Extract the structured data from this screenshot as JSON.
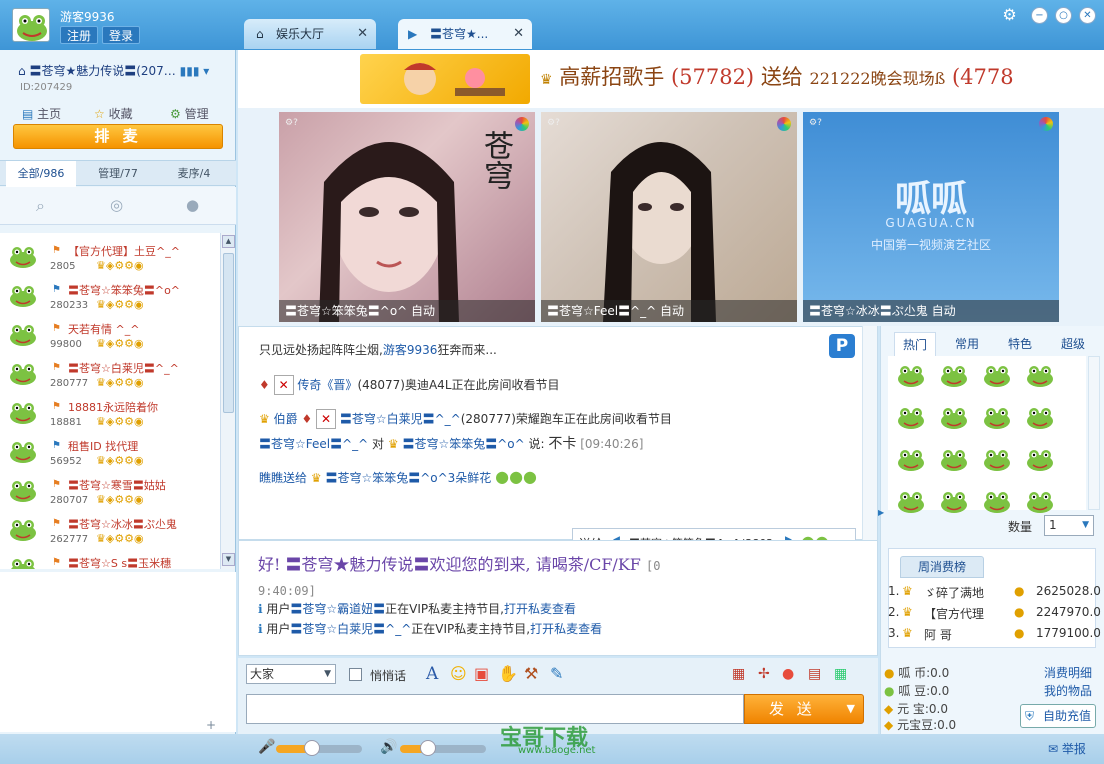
{
  "header": {
    "username": "游客9936",
    "register_label": "注册",
    "login_label": "登录",
    "tabs": [
      {
        "label": "娱乐大厅",
        "close": "✕"
      },
      {
        "label": "〓苍穹★...",
        "close": "✕"
      }
    ]
  },
  "sidebar": {
    "room_name": "〓苍穹★魅力传说〓(207…",
    "room_id": "ID:207429",
    "nav": [
      {
        "label": "主页",
        "icon": "page-icon"
      },
      {
        "label": "收藏",
        "icon": "star-icon"
      },
      {
        "label": "管理",
        "icon": "gear-icon"
      }
    ],
    "queue_button": "排 麦",
    "tabs": [
      {
        "label": "全部/986"
      },
      {
        "label": "管理/77"
      },
      {
        "label": "麦序/4"
      }
    ],
    "users": [
      {
        "name": "【官方代理】土豆^_^",
        "id": "2805",
        "color": "#c0392b"
      },
      {
        "name": "〓苍穹☆笨笨兔〓^o^",
        "id": "280233",
        "color": "#c0392b"
      },
      {
        "name": "天若有情 ^_^",
        "id": "99800",
        "color": "#c0392b"
      },
      {
        "name": "〓苍穹☆白莱児〓^_^",
        "id": "280777",
        "color": "#c0392b"
      },
      {
        "name": "18881永远陪着你",
        "id": "18881",
        "color": "#c0392b"
      },
      {
        "name": "租售ID 找代理",
        "id": "56952",
        "color": "#c0392b"
      },
      {
        "name": "〓苍穹☆寒雪〓姑姑",
        "id": "280707",
        "color": "#c0392b"
      },
      {
        "name": "〓苍穹☆冰冰〓ぷ尐鬼",
        "id": "262777",
        "color": "#c0392b"
      },
      {
        "name": "〓苍穹☆S s〓玉米穗",
        "id": "",
        "color": "#c0392b"
      }
    ]
  },
  "banner": {
    "text_a": "高薪招歌手",
    "num_a": "(57782)",
    "text_b": "送给",
    "text_c": "221222晚会现场ß",
    "num_b": "(4778"
  },
  "videos": [
    {
      "caption": "〓苍穹☆笨笨兔〓^o^  自动",
      "overlay": "苍穹"
    },
    {
      "caption": "〓苍穹☆Feel〓^_^   自动",
      "overlay": ""
    },
    {
      "caption": "〓苍穹☆冰冰〓ぷ尐鬼 自动",
      "overlay": "呱呱",
      "overlay2": "GUAGUA.CN",
      "overlay3": "中国第一视频演艺社区"
    }
  ],
  "chat": {
    "line1": "只见远处扬起阵阵尘烟,",
    "line1_user": "游客9936",
    "line1_tail": "狂奔而来...",
    "line2_user": "传奇《晋》",
    "line2_tail": "(48077)奥迪A4L正在此房间收看节目",
    "line3_user": "伯爵",
    "line3_user2": "〓苍穹☆白莱児〓^_^",
    "line3_tail": "(280777)荣耀跑车正在此房间收看节目",
    "line4_user": "〓苍穹☆Feel〓^_^",
    "line4_to": "对",
    "line4_target": "〓苍穹☆笨笨兔〓^o^",
    "line4_say": "说:",
    "line4_msg": "不卡",
    "line4_time": "[09:40:26]",
    "line5_a": "瞧瞧送给",
    "line5_target": "〓苍穹☆笨笨兔〓^o^3朵鲜花",
    "p_badge": "P"
  },
  "gift_send": {
    "label": "送给",
    "target": "〓苍穹☆笨笨兔〓^o^(2802"
  },
  "public": {
    "welcome": "好! 〓苍穹★魅力传说〓欢迎您的到来, 请喝茶/CF/KF",
    "welcome_time": "[0",
    "welcome_time2": "9:40:09]",
    "sys1_a": "用户",
    "sys1_user": "〓苍穹☆霸道妞〓",
    "sys1_b": "正在VIP私麦主持节目,",
    "sys1_link": "打开私麦查看",
    "sys2_a": "用户",
    "sys2_user": "〓苍穹☆白莱児〓^_^",
    "sys2_b": "正在VIP私麦主持节目,",
    "sys2_link": "打开私麦查看"
  },
  "input": {
    "target": "大家",
    "whisper_label": "悄悄话",
    "send_label": "发 送"
  },
  "right": {
    "tabs": [
      "热门",
      "常用",
      "特色",
      "超级"
    ],
    "qty_label": "数量",
    "qty_value": "1",
    "weekly_title": "周消费榜",
    "ranks": [
      {
        "rank": "1.",
        "name": "ゞ碎了满地",
        "value": "2625028.0"
      },
      {
        "rank": "2.",
        "name": "【官方代理",
        "value": "2247970.0"
      },
      {
        "rank": "3.",
        "name": "阿 哥",
        "value": "1779100.0"
      }
    ],
    "balances": [
      {
        "label": "呱 币:0.0"
      },
      {
        "label": "呱 豆:0.0"
      },
      {
        "label": "元 宝:0.0"
      },
      {
        "label": "元宝豆:0.0"
      }
    ],
    "link1": "消费明细",
    "link2": "我的物品",
    "recharge": "自助充值"
  },
  "bottom": {
    "report": "举报",
    "watermark": "宝哥下载",
    "watermark_url": "www.baoge.net"
  }
}
